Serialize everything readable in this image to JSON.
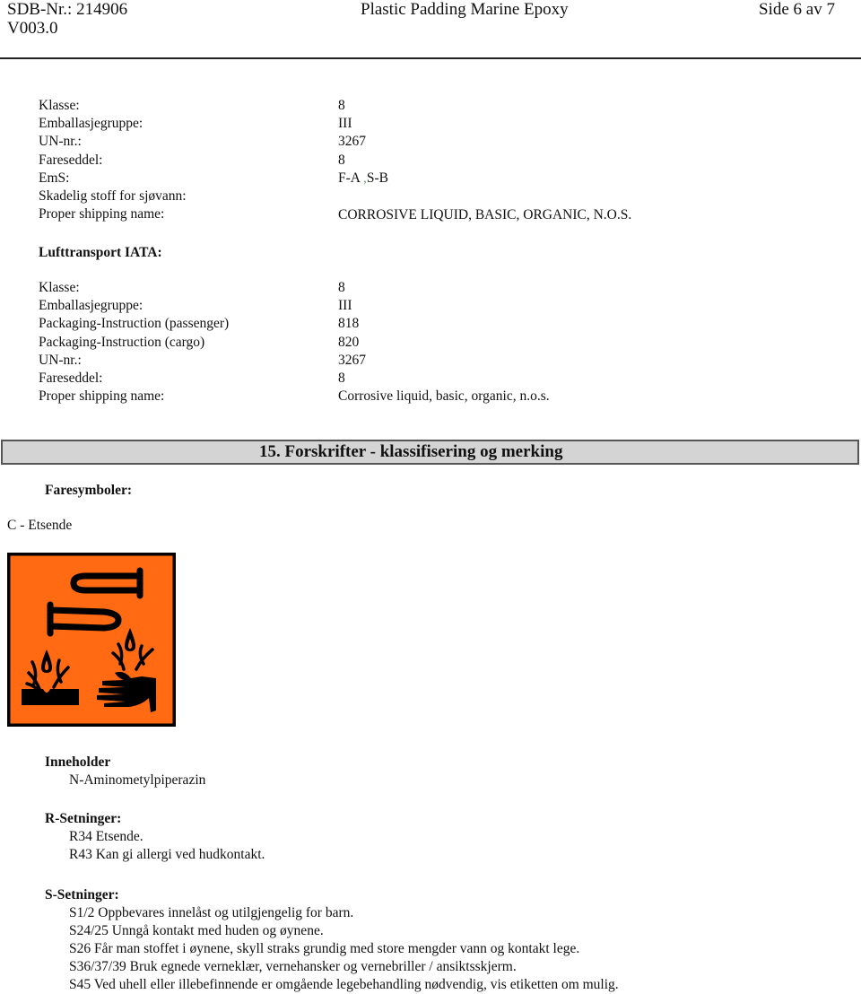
{
  "header": {
    "doc_number": "SDB-Nr.: 214906",
    "version": "V003.0",
    "product_name": "Plastic Padding Marine Epoxy",
    "page": "Side 6 av 7"
  },
  "sea_transport": {
    "rows": [
      {
        "label": "Klasse:",
        "value": "8"
      },
      {
        "label": "Emballasjegruppe:",
        "value": "III"
      },
      {
        "label": "UN-nr.:",
        "value": "3267"
      },
      {
        "label": "Fareseddel:",
        "value": "8"
      },
      {
        "label": "EmS:",
        "value_a": "F-A",
        "value_sep": ",",
        "value_b": "S-B"
      },
      {
        "label": "Skadelig stoff for sjøvann:",
        "value": ""
      },
      {
        "label": "Proper shipping name:",
        "value": "CORROSIVE LIQUID, BASIC, ORGANIC, N.O.S."
      }
    ]
  },
  "air_transport": {
    "heading": "Lufttransport IATA:",
    "rows": [
      {
        "label": "Klasse:",
        "value": "8"
      },
      {
        "label": "Emballasjegruppe:",
        "value": "III"
      },
      {
        "label": "Packaging-Instruction (passenger)",
        "value": "818"
      },
      {
        "label": "Packaging-Instruction (cargo)",
        "value": "820"
      },
      {
        "label": "UN-nr.:",
        "value": "3267"
      },
      {
        "label": "Fareseddel:",
        "value": "8"
      },
      {
        "label": "Proper shipping name:",
        "value": "Corrosive liquid, basic, organic, n.o.s."
      }
    ]
  },
  "section15": {
    "title": "15.  Forskrifter - klassifisering og merking",
    "hazard_symbols_heading": "Faresymboler:",
    "hazard_symbol_label": "C - Etsende",
    "hazard_pictogram": "corrosive-pictogram",
    "pictogram_colors": {
      "background": "#ff6a13",
      "foreground": "#000000"
    },
    "contains_heading": "Inneholder",
    "contains": [
      "N-Aminometylpiperazin"
    ],
    "r_phrases_heading": "R-Setninger:",
    "r_phrases": [
      "R34 Etsende.",
      "R43 Kan gi allergi ved hudkontakt."
    ],
    "s_phrases_heading": "S-Setninger:",
    "s_phrases": [
      "S1/2 Oppbevares innelåst og utilgjengelig for barn.",
      "S24/25 Unngå kontakt med huden og øynene.",
      "S26 Får man stoffet i øynene, skyll straks grundig med store mengder vann og kontakt lege.",
      "S36/37/39 Bruk egnede verneklær, vernehansker og vernebriller / ansiktsskjerm.",
      "S45 Ved uhell eller illebefinnende er omgående legebehandling nødvendig, vis etiketten om mulig."
    ]
  }
}
